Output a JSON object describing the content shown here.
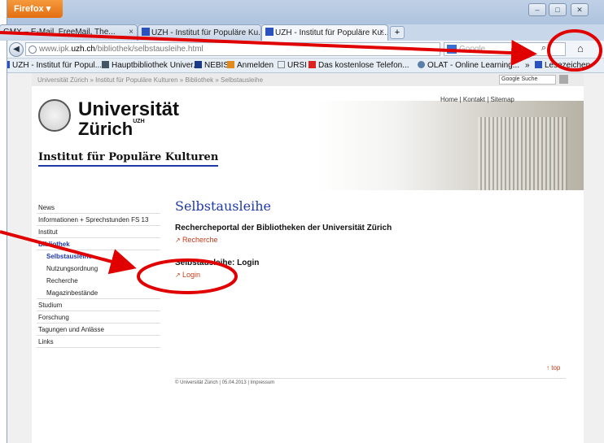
{
  "browser": {
    "menu_label": "Firefox",
    "window_controls": [
      "–",
      "□",
      "✕"
    ],
    "tabs": [
      {
        "label": "GMX – E-Mail, FreeMail, The..."
      },
      {
        "label": "UZH - Institut für Populäre Ku..."
      },
      {
        "label": "UZH - Institut für Populäre Ku..."
      }
    ],
    "new_tab": "+",
    "back": "◀",
    "url_prefix": "www.ipk.",
    "url_domain": "uzh.ch",
    "url_path": "/bibliothek/selbstausleihe.html",
    "search_placeholder": "Google",
    "bookmarks": [
      "UZH - Institut für Popul...",
      "Hauptbibliothek Univer...",
      "NEBIS",
      "Anmelden",
      "URSI",
      "Das kostenlose Telefon...",
      "OLAT - Online Learning...",
      "»",
      "Lesezeichen"
    ]
  },
  "page": {
    "breadcrumb": "Universität Zürich » Institut für Populäre Kulturen » Bibliothek » Selbstausleihe",
    "google_search": "Google Suche",
    "toplinks": "Home | Kontakt | Sitemap",
    "uni_line1": "Universität",
    "uni_line2": "Zürich",
    "uni_sup": "UZH",
    "institute": "Institut für Populäre Kulturen",
    "sidebar": [
      {
        "label": "News"
      },
      {
        "label": "Informationen + Sprechstunden FS 13"
      },
      {
        "label": "Institut"
      },
      {
        "label": "Bibliothek"
      },
      {
        "label": "Selbstausleihe"
      },
      {
        "label": "Nutzungsordnung"
      },
      {
        "label": "Recherche"
      },
      {
        "label": "Magazinbestände"
      },
      {
        "label": "Studium"
      },
      {
        "label": "Forschung"
      },
      {
        "label": "Tagungen und Anlässe"
      },
      {
        "label": "Links"
      }
    ],
    "title": "Selbstausleihe",
    "section1_heading": "Rechercheportal der Bibliotheken der Universität Zürich",
    "section1_link": "Recherche",
    "section2_heading": "Selbstausleihe: Login",
    "section2_link": "Login",
    "top_link": "top",
    "footer": "© Universität Zürich | 05.04.2013 | Impressum"
  },
  "colors": {
    "accent_blue": "#1f3aa6",
    "link_red": "#c43c1a",
    "annotation_red": "#e00000"
  }
}
